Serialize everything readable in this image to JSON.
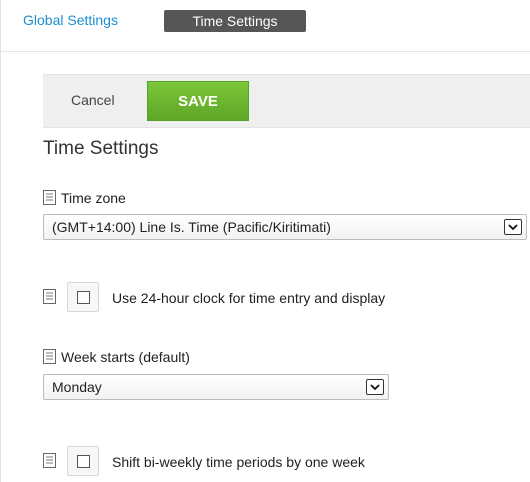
{
  "tabs": {
    "global_label": "Global Settings",
    "time_label": "Time Settings"
  },
  "actions": {
    "cancel_label": "Cancel",
    "save_label": "SAVE"
  },
  "section": {
    "title": "Time Settings"
  },
  "fields": {
    "timezone": {
      "label": "Time zone",
      "value": "(GMT+14:00) Line Is. Time (Pacific/Kiritimati)"
    },
    "clock24": {
      "label": "Use 24-hour clock for time entry and display",
      "checked": false
    },
    "week_start": {
      "label": "Week starts (default)",
      "value": "Monday"
    },
    "shift_biweekly": {
      "label": "Shift bi-weekly time periods by one week",
      "checked": false
    }
  },
  "colors": {
    "tab_link": "#1a8fd0",
    "active_tab_bg": "#565656",
    "save_bg": "#6cb52f"
  },
  "icons": {
    "field_help": "document-icon",
    "dropdown": "chevron-down-icon"
  }
}
